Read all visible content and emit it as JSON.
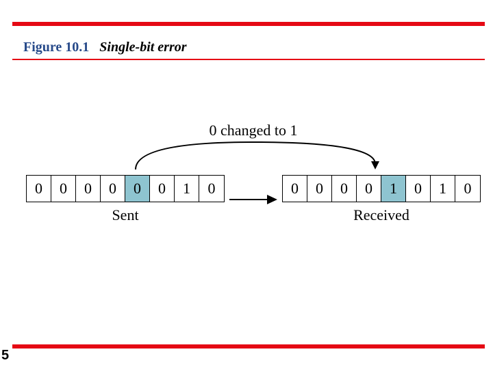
{
  "figure": {
    "label": "Figure 10.1",
    "caption": "Single-bit error"
  },
  "annotation": "0 changed to 1",
  "sent": {
    "label": "Sent",
    "bits": [
      "0",
      "0",
      "0",
      "0",
      "0",
      "0",
      "1",
      "0"
    ],
    "highlight_index": 4
  },
  "received": {
    "label": "Received",
    "bits": [
      "0",
      "0",
      "0",
      "0",
      "1",
      "0",
      "1",
      "0"
    ],
    "highlight_index": 4
  },
  "page": "5",
  "chart_data": {
    "type": "diagram",
    "title": "Single-bit error",
    "sent_bits": [
      0,
      0,
      0,
      0,
      0,
      0,
      1,
      0
    ],
    "received_bits": [
      0,
      0,
      0,
      0,
      1,
      0,
      1,
      0
    ],
    "changed_bit_index": 4,
    "change_description": "bit at index 4 flipped from 0 to 1"
  }
}
